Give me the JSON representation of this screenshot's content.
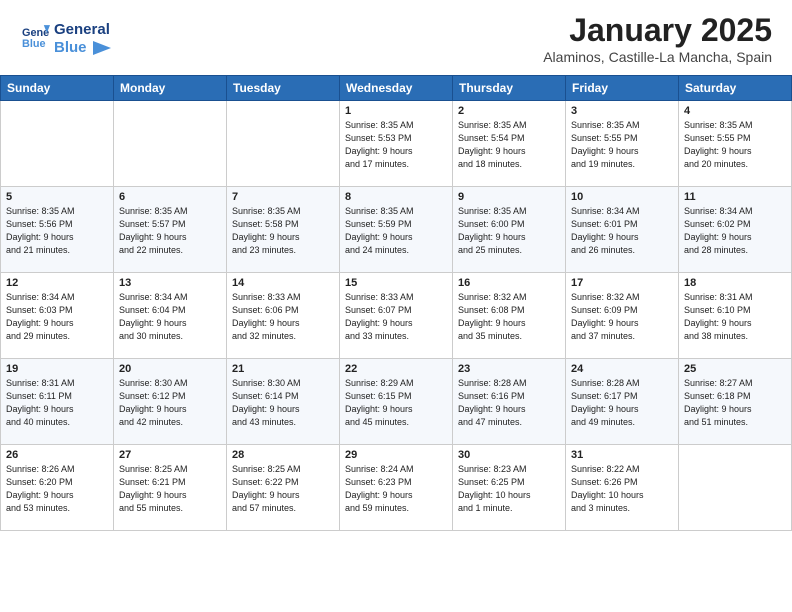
{
  "header": {
    "logo_line1": "General",
    "logo_line2": "Blue",
    "month": "January 2025",
    "location": "Alaminos, Castille-La Mancha, Spain"
  },
  "weekdays": [
    "Sunday",
    "Monday",
    "Tuesday",
    "Wednesday",
    "Thursday",
    "Friday",
    "Saturday"
  ],
  "weeks": [
    [
      {
        "day": null,
        "info": null
      },
      {
        "day": null,
        "info": null
      },
      {
        "day": null,
        "info": null
      },
      {
        "day": "1",
        "info": "Sunrise: 8:35 AM\nSunset: 5:53 PM\nDaylight: 9 hours\nand 17 minutes."
      },
      {
        "day": "2",
        "info": "Sunrise: 8:35 AM\nSunset: 5:54 PM\nDaylight: 9 hours\nand 18 minutes."
      },
      {
        "day": "3",
        "info": "Sunrise: 8:35 AM\nSunset: 5:55 PM\nDaylight: 9 hours\nand 19 minutes."
      },
      {
        "day": "4",
        "info": "Sunrise: 8:35 AM\nSunset: 5:55 PM\nDaylight: 9 hours\nand 20 minutes."
      }
    ],
    [
      {
        "day": "5",
        "info": "Sunrise: 8:35 AM\nSunset: 5:56 PM\nDaylight: 9 hours\nand 21 minutes."
      },
      {
        "day": "6",
        "info": "Sunrise: 8:35 AM\nSunset: 5:57 PM\nDaylight: 9 hours\nand 22 minutes."
      },
      {
        "day": "7",
        "info": "Sunrise: 8:35 AM\nSunset: 5:58 PM\nDaylight: 9 hours\nand 23 minutes."
      },
      {
        "day": "8",
        "info": "Sunrise: 8:35 AM\nSunset: 5:59 PM\nDaylight: 9 hours\nand 24 minutes."
      },
      {
        "day": "9",
        "info": "Sunrise: 8:35 AM\nSunset: 6:00 PM\nDaylight: 9 hours\nand 25 minutes."
      },
      {
        "day": "10",
        "info": "Sunrise: 8:34 AM\nSunset: 6:01 PM\nDaylight: 9 hours\nand 26 minutes."
      },
      {
        "day": "11",
        "info": "Sunrise: 8:34 AM\nSunset: 6:02 PM\nDaylight: 9 hours\nand 28 minutes."
      }
    ],
    [
      {
        "day": "12",
        "info": "Sunrise: 8:34 AM\nSunset: 6:03 PM\nDaylight: 9 hours\nand 29 minutes."
      },
      {
        "day": "13",
        "info": "Sunrise: 8:34 AM\nSunset: 6:04 PM\nDaylight: 9 hours\nand 30 minutes."
      },
      {
        "day": "14",
        "info": "Sunrise: 8:33 AM\nSunset: 6:06 PM\nDaylight: 9 hours\nand 32 minutes."
      },
      {
        "day": "15",
        "info": "Sunrise: 8:33 AM\nSunset: 6:07 PM\nDaylight: 9 hours\nand 33 minutes."
      },
      {
        "day": "16",
        "info": "Sunrise: 8:32 AM\nSunset: 6:08 PM\nDaylight: 9 hours\nand 35 minutes."
      },
      {
        "day": "17",
        "info": "Sunrise: 8:32 AM\nSunset: 6:09 PM\nDaylight: 9 hours\nand 37 minutes."
      },
      {
        "day": "18",
        "info": "Sunrise: 8:31 AM\nSunset: 6:10 PM\nDaylight: 9 hours\nand 38 minutes."
      }
    ],
    [
      {
        "day": "19",
        "info": "Sunrise: 8:31 AM\nSunset: 6:11 PM\nDaylight: 9 hours\nand 40 minutes."
      },
      {
        "day": "20",
        "info": "Sunrise: 8:30 AM\nSunset: 6:12 PM\nDaylight: 9 hours\nand 42 minutes."
      },
      {
        "day": "21",
        "info": "Sunrise: 8:30 AM\nSunset: 6:14 PM\nDaylight: 9 hours\nand 43 minutes."
      },
      {
        "day": "22",
        "info": "Sunrise: 8:29 AM\nSunset: 6:15 PM\nDaylight: 9 hours\nand 45 minutes."
      },
      {
        "day": "23",
        "info": "Sunrise: 8:28 AM\nSunset: 6:16 PM\nDaylight: 9 hours\nand 47 minutes."
      },
      {
        "day": "24",
        "info": "Sunrise: 8:28 AM\nSunset: 6:17 PM\nDaylight: 9 hours\nand 49 minutes."
      },
      {
        "day": "25",
        "info": "Sunrise: 8:27 AM\nSunset: 6:18 PM\nDaylight: 9 hours\nand 51 minutes."
      }
    ],
    [
      {
        "day": "26",
        "info": "Sunrise: 8:26 AM\nSunset: 6:20 PM\nDaylight: 9 hours\nand 53 minutes."
      },
      {
        "day": "27",
        "info": "Sunrise: 8:25 AM\nSunset: 6:21 PM\nDaylight: 9 hours\nand 55 minutes."
      },
      {
        "day": "28",
        "info": "Sunrise: 8:25 AM\nSunset: 6:22 PM\nDaylight: 9 hours\nand 57 minutes."
      },
      {
        "day": "29",
        "info": "Sunrise: 8:24 AM\nSunset: 6:23 PM\nDaylight: 9 hours\nand 59 minutes."
      },
      {
        "day": "30",
        "info": "Sunrise: 8:23 AM\nSunset: 6:25 PM\nDaylight: 10 hours\nand 1 minute."
      },
      {
        "day": "31",
        "info": "Sunrise: 8:22 AM\nSunset: 6:26 PM\nDaylight: 10 hours\nand 3 minutes."
      },
      {
        "day": null,
        "info": null
      }
    ]
  ]
}
